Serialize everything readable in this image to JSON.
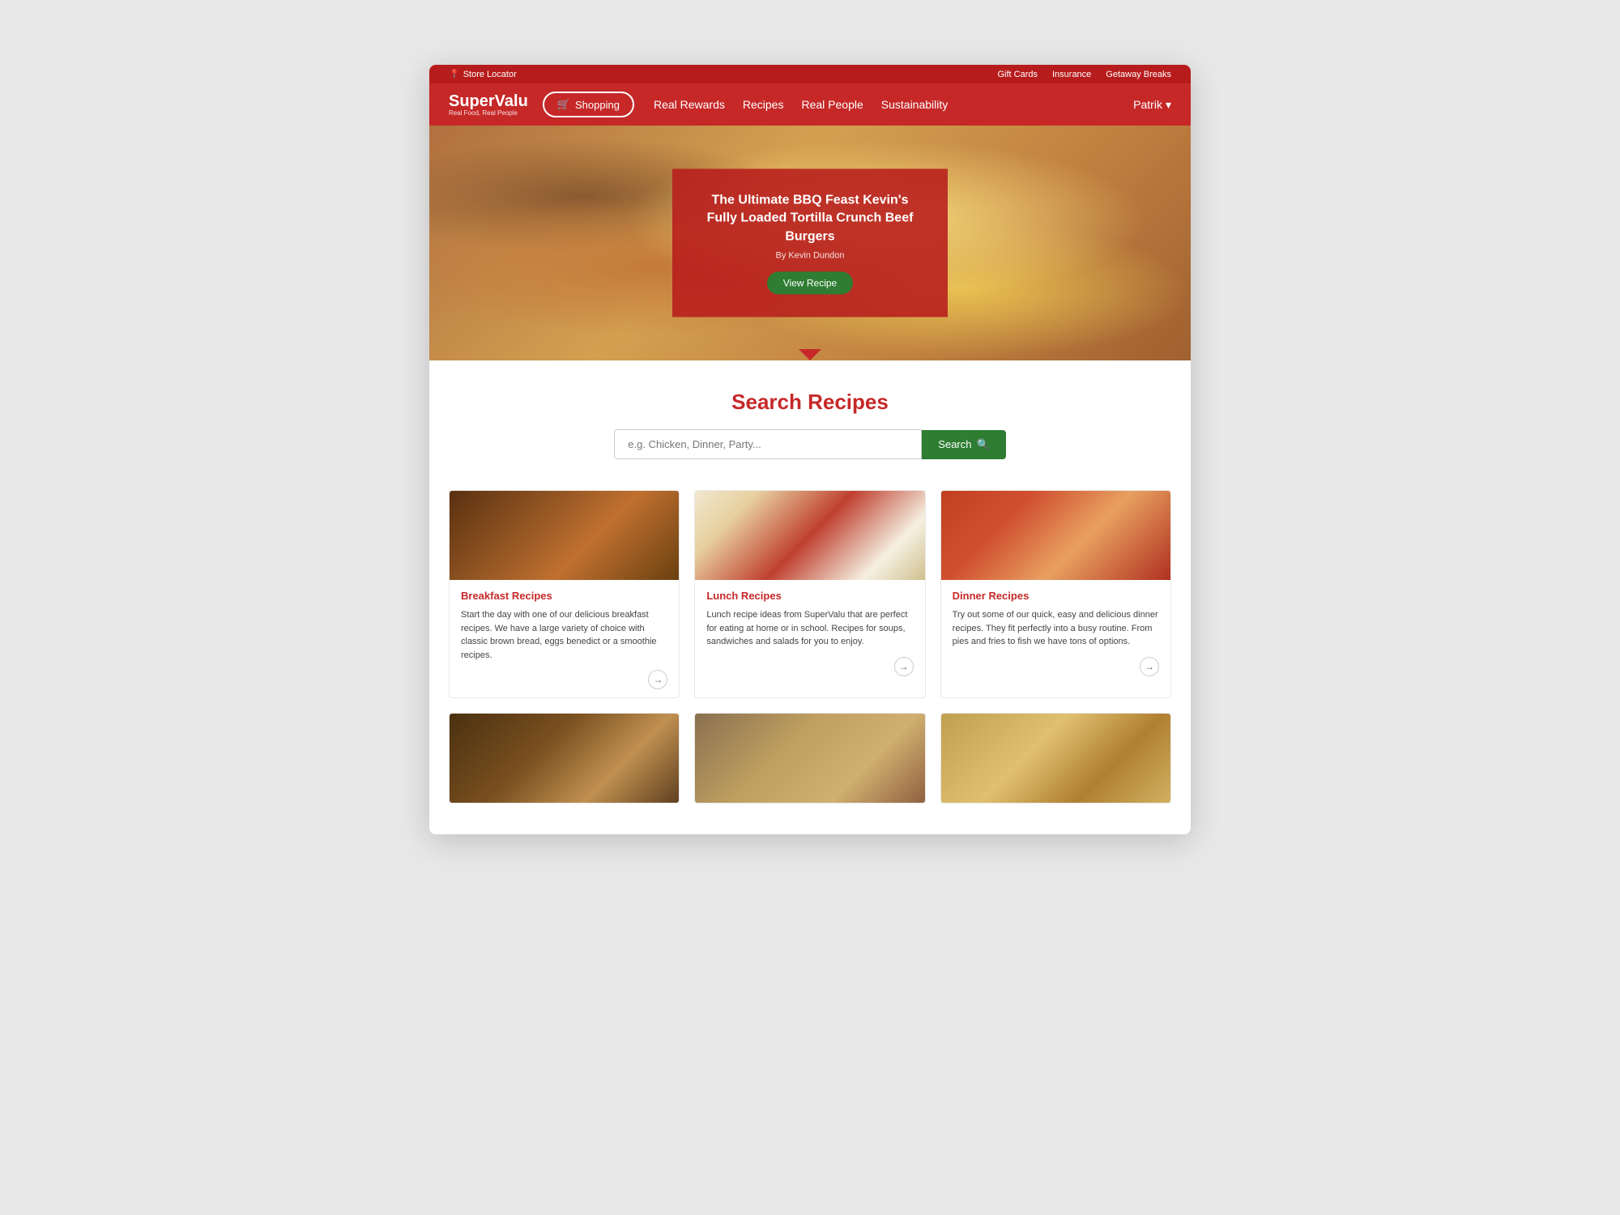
{
  "utilBar": {
    "storeLocator": "Store Locator",
    "giftCards": "Gift Cards",
    "insurance": "Insurance",
    "getawayBreaks": "Getaway Breaks"
  },
  "nav": {
    "logoName": "SuperValu",
    "logoSub": "Real Food, Real People",
    "shoppingLabel": "Shopping",
    "links": [
      {
        "label": "Real Rewards",
        "id": "real-rewards"
      },
      {
        "label": "Recipes",
        "id": "recipes"
      },
      {
        "label": "Real People",
        "id": "real-people"
      },
      {
        "label": "Sustainability",
        "id": "sustainability"
      }
    ],
    "userName": "Patrik",
    "chevron": "▾"
  },
  "hero": {
    "title": "The Ultimate BBQ Feast Kevin's Fully Loaded Tortilla Crunch Beef Burgers",
    "byLine": "By Kevin Dundon",
    "btnLabel": "View Recipe"
  },
  "searchSection": {
    "title": "Search Recipes",
    "inputPlaceholder": "e.g. Chicken, Dinner, Party...",
    "btnLabel": "Search",
    "searchIcon": "🔍"
  },
  "recipeCards": {
    "row1": [
      {
        "title": "Breakfast Recipes",
        "text": "Start the day with one of our delicious breakfast recipes. We have a large variety of choice with classic brown bread, eggs benedict or a smoothie recipes.",
        "imgTheme": "breakfast"
      },
      {
        "title": "Lunch Recipes",
        "text": "Lunch recipe ideas from SuperValu that are perfect for eating at home or in school. Recipes for soups, sandwiches and salads for you to enjoy.",
        "imgTheme": "lunch"
      },
      {
        "title": "Dinner Recipes",
        "text": "Try out some of our quick, easy and delicious dinner recipes. They fit perfectly into a busy routine. From pies and fries to fish we have tons of options.",
        "imgTheme": "dinner"
      }
    ],
    "row2": [
      {
        "imgTheme": "bottom1"
      },
      {
        "imgTheme": "bottom2"
      },
      {
        "imgTheme": "bottom3"
      }
    ]
  }
}
